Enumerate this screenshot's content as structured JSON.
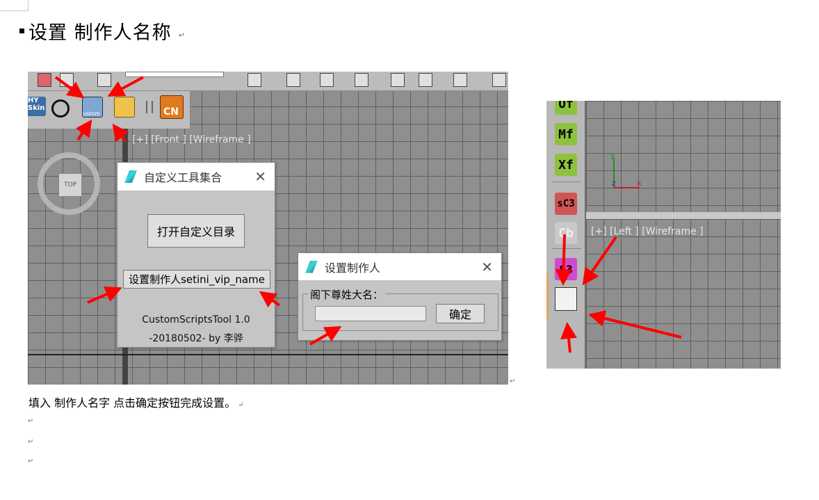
{
  "heading": {
    "text": "设置 制作人名称",
    "mark": "↵"
  },
  "viewport_labels": {
    "front": "[+] [Front ] [Wireframe ]",
    "left": "[+] [Left ] [Wireframe ]"
  },
  "viewcube": {
    "face": "TOP"
  },
  "toolbar_shelf": [
    {
      "icon": "hy-skin-icon",
      "label": "HY Skin"
    },
    {
      "icon": "rotate-icon",
      "label": ""
    },
    {
      "icon": "custom-tools-icon",
      "label": "ustom"
    },
    {
      "icon": "folder-search-icon",
      "label": ""
    },
    {
      "icon": "cn-arrow-icon",
      "label": "CN"
    }
  ],
  "dialog_tools": {
    "title": "自定义工具集合",
    "open_dir_button": "打开自定义目录",
    "set_producer_button": "设置制作人setini_vip_name",
    "about_line1": "CustomScriptsTool 1.0",
    "about_line2": "-20180502- by 李骅"
  },
  "dialog_producer": {
    "title": "设置制作人",
    "group_label": "阁下尊姓大名：",
    "name_value": "",
    "ok_button": "确定"
  },
  "side_buttons": [
    {
      "label": "Of",
      "color": "#8dc23f"
    },
    {
      "label": "Mf",
      "color": "#8dc23f"
    },
    {
      "label": "Xf",
      "color": "#8dc23f"
    },
    {
      "label": "sC3",
      "color": "#d05555"
    },
    {
      "label": "Cb",
      "color": "#c9c9c9"
    },
    {
      "label": "S3",
      "color": "#cc4ccc"
    }
  ],
  "axis_labels": {
    "y": "y",
    "x": "x",
    "z": "z"
  },
  "caption": "填入 制作人名字 点击确定按钮完成设置。",
  "caption_mark": "↵",
  "empty_marks": [
    "↵",
    "↵",
    "↵"
  ],
  "image_end_mark": "↵",
  "colors": {
    "arrow": "#ff0000",
    "viewport_bg": "#8f8f8f",
    "grid_line": "#5f5f5f",
    "dialog_bg": "#c5c5c5"
  }
}
